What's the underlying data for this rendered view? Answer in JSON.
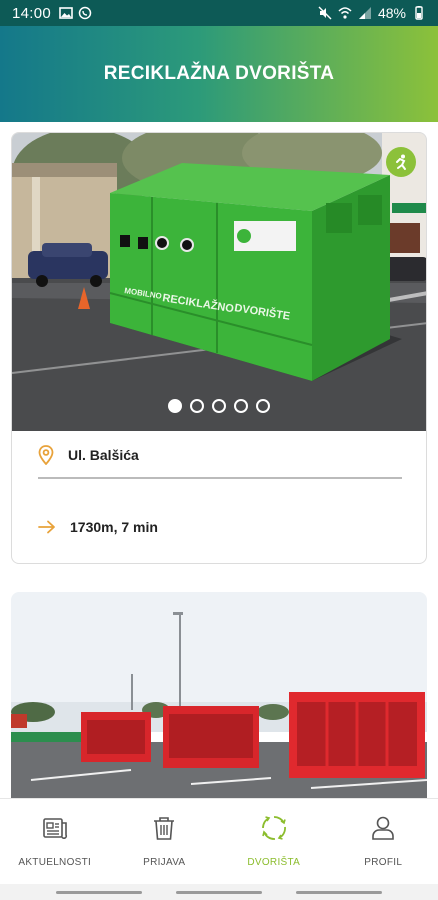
{
  "status_bar": {
    "time": "14:00",
    "battery": "48%",
    "icons_left": [
      "image-icon",
      "viber-icon"
    ],
    "icons_right": [
      "mute-icon",
      "wifi-icon",
      "signal-icon",
      "battery-icon"
    ]
  },
  "header": {
    "title": "RECIKLAŽNA DVORIŠTA",
    "gradient_start": "#14788a",
    "gradient_end": "#8cc13a"
  },
  "cards": [
    {
      "address": "Ul. Balšića",
      "distance": "1730m, 7 min",
      "image_count": 5,
      "active_image": 0,
      "container_labels": [
        "RECIKLAŽNO",
        "DVORIŠTE"
      ]
    }
  ],
  "nav": {
    "items": [
      {
        "label": "AKTUELNOSTI",
        "icon": "news-icon",
        "active": false
      },
      {
        "label": "PRIJAVA",
        "icon": "trash-icon",
        "active": false
      },
      {
        "label": "DVORIŠTA",
        "icon": "recycle-icon",
        "active": true
      },
      {
        "label": "PROFIL",
        "icon": "profile-icon",
        "active": false
      }
    ]
  },
  "colors": {
    "accent": "#8cbd2e",
    "status_bar": "#0d5a56",
    "icon_orange": "#e8a23a"
  }
}
